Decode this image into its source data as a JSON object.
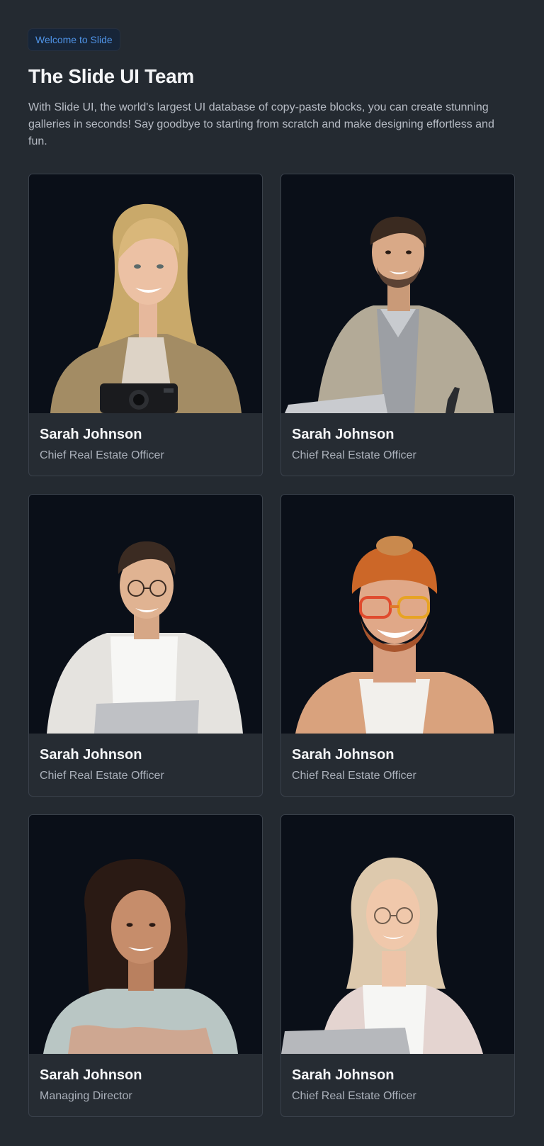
{
  "header": {
    "badge": "Welcome to Slide",
    "title": "The Slide UI Team",
    "description": "With Slide UI, the world's largest UI database of copy-paste blocks, you can create stunning galleries in seconds! Say goodbye to starting from scratch and make designing effortless and fun."
  },
  "team": [
    {
      "name": "Sarah Johnson",
      "role": "Chief Real Estate Officer"
    },
    {
      "name": "Sarah Johnson",
      "role": "Chief Real Estate Officer"
    },
    {
      "name": "Sarah Johnson",
      "role": "Chief Real Estate Officer"
    },
    {
      "name": "Sarah Johnson",
      "role": "Chief Real Estate Officer"
    },
    {
      "name": "Sarah Johnson",
      "role": "Managing Director"
    },
    {
      "name": "Sarah Johnson",
      "role": "Chief Real Estate Officer"
    }
  ]
}
